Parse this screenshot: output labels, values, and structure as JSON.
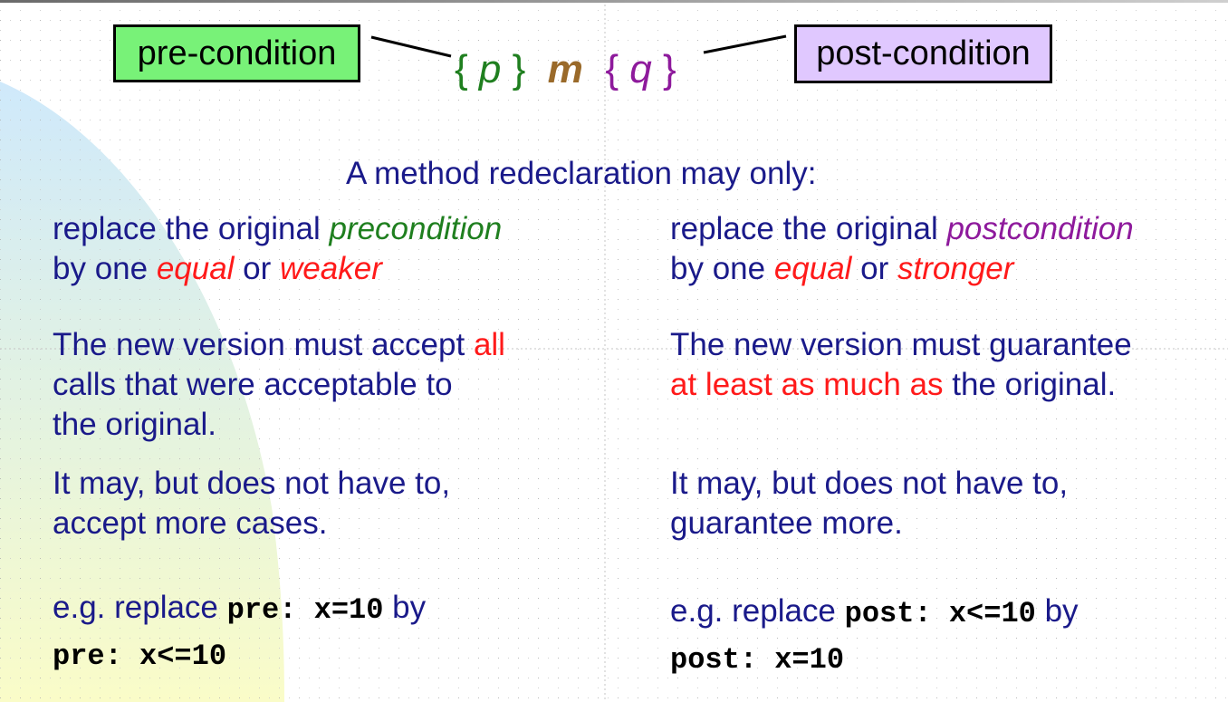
{
  "diagram": {
    "pre_label": "pre-condition",
    "post_label": "post-condition",
    "formula": {
      "open1": "{ ",
      "p": "p",
      "close1": " }",
      "m": "m",
      "open2": "{ ",
      "q": "q",
      "close2": " }"
    }
  },
  "heading": "A method redeclaration may only:",
  "left": {
    "rule_a": "replace the original ",
    "rule_term": "precondition",
    "rule_b": "by one ",
    "rule_equal": "equal",
    "rule_or": " or ",
    "rule_weak": "weaker",
    "accept_a": "The new version must accept ",
    "accept_all": "all",
    "accept_b": "calls  that were acceptable to",
    "accept_c": "the original.",
    "may_a": "It may, but does not have to,",
    "may_b": "accept more cases.",
    "eg_a": "e.g. replace ",
    "eg_code1": "pre: x=10",
    "eg_by": " by",
    "eg_code2": "pre: x<=10"
  },
  "right": {
    "rule_a": "replace the original ",
    "rule_term": "postcondition",
    "rule_b": "by one ",
    "rule_equal": "equal",
    "rule_or": " or ",
    "rule_strong": "stronger",
    "guar_a": "The new version must guarantee",
    "guar_red": "at least as much as",
    "guar_b": " the original.",
    "may_a": "It may, but does not have to,",
    "may_b": "guarantee more.",
    "eg_a": "e.g. replace ",
    "eg_code1": "post: x<=10",
    "eg_by": " by",
    "eg_code2": "post: x=10"
  },
  "colors": {
    "text": "#1a1a8a",
    "emphasis_red": "#ff1a1a",
    "precondition_green": "#1f7f1f",
    "postcondition_purple": "#8e1a9c",
    "pre_box": "#78f278",
    "post_box": "#e0c8ff",
    "method_brown": "#9a6a2a"
  }
}
